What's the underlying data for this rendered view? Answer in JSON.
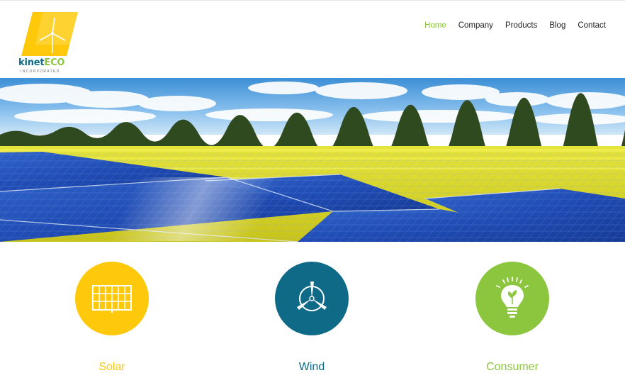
{
  "brand": {
    "name_part1": "kinet",
    "name_part2": "ECO",
    "subtitle": "INCORPORATED",
    "logo_icon": "wind-turbine-icon"
  },
  "nav": {
    "items": [
      {
        "label": "Home",
        "active": true
      },
      {
        "label": "Company",
        "active": false
      },
      {
        "label": "Products",
        "active": false
      },
      {
        "label": "Blog",
        "active": false
      },
      {
        "label": "Contact",
        "active": false
      }
    ]
  },
  "hero": {
    "image": "solar-panels-rapeseed-field"
  },
  "features": [
    {
      "title": "Solar",
      "icon": "solar-panel-icon",
      "color": "#fdc90a"
    },
    {
      "title": "Wind",
      "icon": "wind-turbine-icon",
      "color": "#0e6a86"
    },
    {
      "title": "Consumer",
      "icon": "lightbulb-plant-icon",
      "color": "#8cc63e"
    }
  ],
  "colors": {
    "brand_yellow": "#fdc90a",
    "brand_blue": "#0e6a86",
    "brand_green": "#8cc63e",
    "nav_text": "#222222"
  }
}
